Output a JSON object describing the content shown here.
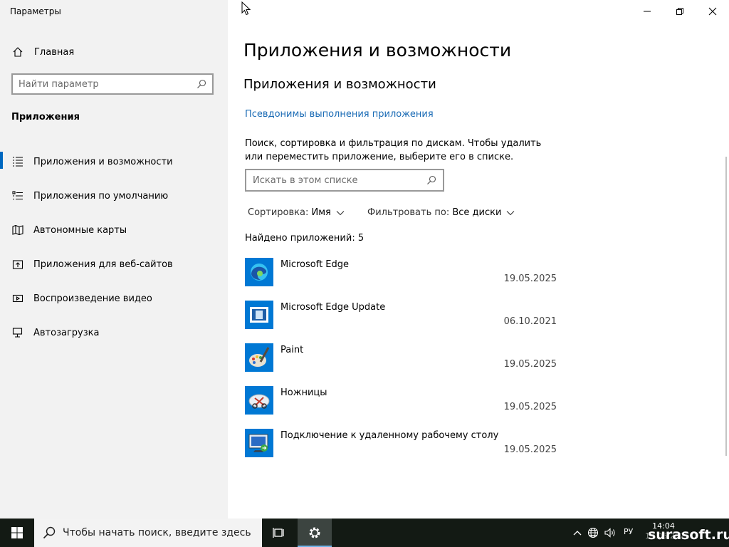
{
  "window": {
    "title": "Параметры"
  },
  "sidebar": {
    "home_label": "Главная",
    "search_placeholder": "Найти параметр",
    "section_title": "Приложения",
    "items": [
      {
        "label": "Приложения и возможности",
        "icon": "apps-features-icon",
        "active": true
      },
      {
        "label": "Приложения по умолчанию",
        "icon": "default-apps-icon",
        "active": false
      },
      {
        "label": "Автономные карты",
        "icon": "offline-maps-icon",
        "active": false
      },
      {
        "label": "Приложения для веб-сайтов",
        "icon": "apps-for-websites-icon",
        "active": false
      },
      {
        "label": "Воспроизведение видео",
        "icon": "video-playback-icon",
        "active": false
      },
      {
        "label": "Автозагрузка",
        "icon": "startup-icon",
        "active": false
      }
    ]
  },
  "main": {
    "page_title": "Приложения и возможности",
    "section_title": "Приложения и возможности",
    "alias_link": "Псевдонимы выполнения приложения",
    "description": "Поиск, сортировка и фильтрация по дискам. Чтобы удалить или переместить приложение, выберите его в списке.",
    "search_placeholder": "Искать в этом списке",
    "sort_label": "Сортировка:",
    "sort_value": "Имя",
    "filter_label": "Фильтровать по:",
    "filter_value": "Все диски",
    "found_label": "Найдено приложений: 5",
    "apps": [
      {
        "name": "Microsoft Edge",
        "date": "19.05.2025",
        "icon": "edge-icon"
      },
      {
        "name": "Microsoft Edge Update",
        "date": "06.10.2021",
        "icon": "edge-update-icon"
      },
      {
        "name": "Paint",
        "date": "19.05.2025",
        "icon": "paint-icon"
      },
      {
        "name": "Ножницы",
        "date": "19.05.2025",
        "icon": "snipping-tool-icon"
      },
      {
        "name": "Подключение к удаленному рабочему столу",
        "date": "19.05.2025",
        "icon": "remote-desktop-icon"
      }
    ]
  },
  "taskbar": {
    "search_placeholder": "Чтобы начать поиск, введите здесь",
    "lang": "РУ",
    "time": "14:04",
    "date": "19.05.2025",
    "watermark": "surasoft.ru"
  },
  "colors": {
    "accent": "#0067c0",
    "link": "#1a6bb5",
    "sidebar_bg": "#f2f2f2",
    "taskbar_bg": "#131a14",
    "app_tile": "#0078d4"
  }
}
